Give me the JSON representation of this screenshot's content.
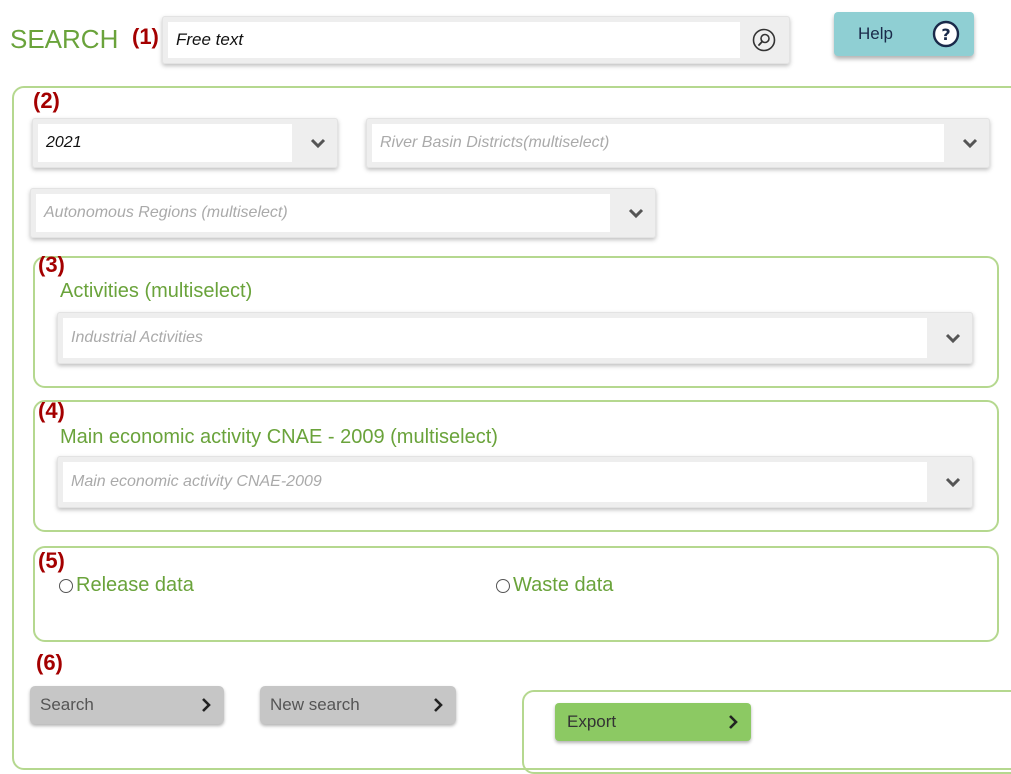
{
  "header": {
    "title": "SEARCH",
    "label_1": "(1)",
    "free_text_value": "Free text",
    "help_label": "Help",
    "help_icon": "question-circle-icon",
    "search_icon": "magnifier-icon"
  },
  "filters": {
    "label_2": "(2)",
    "year_value": "2021",
    "river_basin_placeholder": "River Basin Districts(multiselect)",
    "autonomous_regions_placeholder": "Autonomous Regions (multiselect)"
  },
  "activities": {
    "label": "(3)",
    "title": "Activities (multiselect)",
    "placeholder": "Industrial Activities"
  },
  "cnae": {
    "label": "(4)",
    "title": "Main economic activity CNAE - 2009 (multiselect)",
    "placeholder": "Main economic activity CNAE-2009"
  },
  "data_type": {
    "label": "(5)",
    "release_label": "Release data",
    "waste_label": "Waste data"
  },
  "actions": {
    "label": "(6)",
    "search_label": "Search",
    "new_search_label": "New search",
    "export_label": "Export"
  },
  "colors": {
    "brand_green": "#6aa33b",
    "border_green": "#b5d88f",
    "help_teal": "#8fcfd3",
    "export_green": "#8cc963",
    "label_red": "#a40000"
  }
}
